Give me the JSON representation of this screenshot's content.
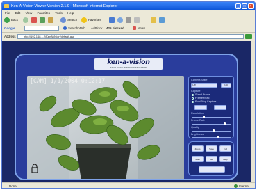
{
  "window": {
    "title": "Ken-A-Vision Viewer Version 2.1.9 - Microsoft Internet Explorer"
  },
  "menu": [
    "File",
    "Edit",
    "View",
    "Favorites",
    "Tools",
    "Help"
  ],
  "toolbar": {
    "back": "Back",
    "search": "Search",
    "favorites": "Favorites"
  },
  "google_bar": {
    "label": "Google",
    "search_web": "Search Web",
    "ad_label": "AdBlock",
    "news": "News"
  },
  "address": {
    "label": "Address",
    "value": "http://192.168.1.2/KenAVision/default.asp"
  },
  "status": {
    "left": "Done",
    "zone": "Internet"
  },
  "viewer": {
    "logo": "ken-a-vision",
    "tagline": "EXCELLENCE IN SCIENCE EDUCATION",
    "timestamp": "[CAM] 1/1/2004 0:12:17",
    "camera_state": "Camera State",
    "camera_state_value": "Off",
    "camera_state_button": "Go",
    "capture_label": "Capture",
    "radio_options": [
      "Stand Frame",
      "Frames/Sec",
      "Run/Stop Capture"
    ],
    "brightness_label": "Resolution",
    "framerate_label": "Frame Rate",
    "quality_label": "Quality",
    "brightness2_label": "Brightness",
    "contrast_label": "Contrast",
    "ctrl_buttons": [
      "Zoom",
      "Save",
      "Full",
      "Snap",
      "Rec",
      "Help"
    ]
  },
  "colors": {
    "accent": "#2a3d9c",
    "border": "#7fa3e8",
    "titlebar": "#0b52d6"
  }
}
